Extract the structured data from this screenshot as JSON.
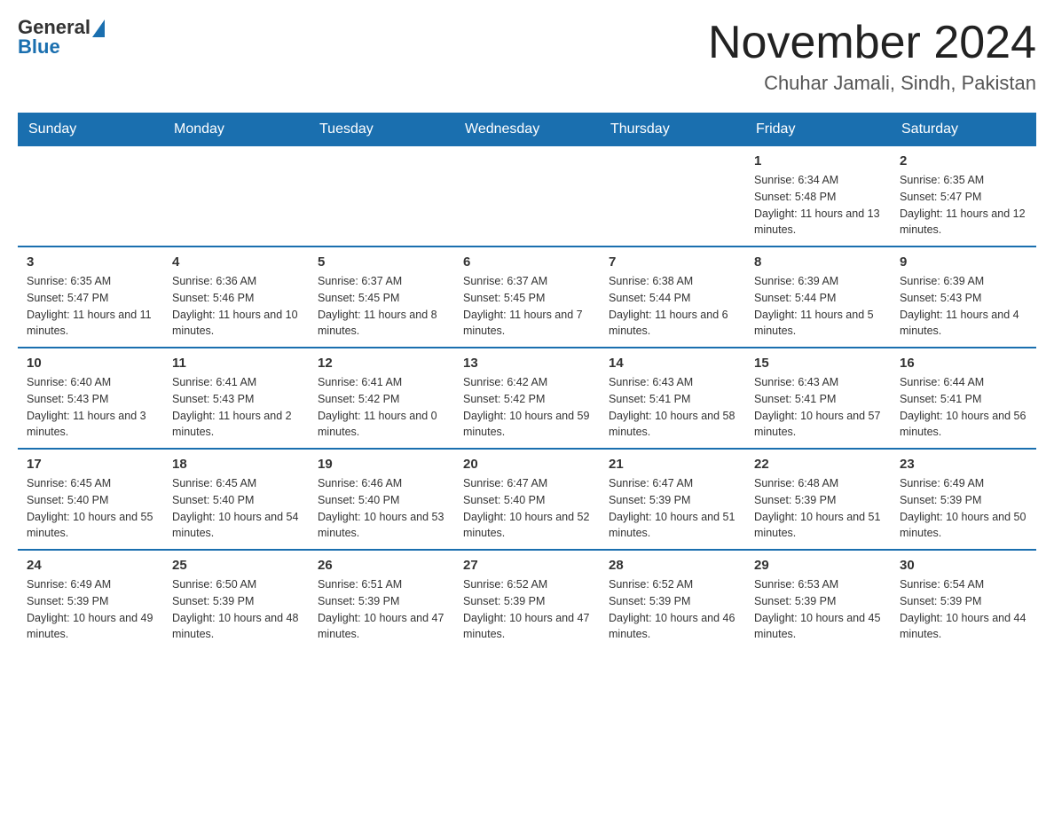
{
  "header": {
    "logo": {
      "general": "General",
      "blue": "Blue"
    },
    "title": "November 2024",
    "subtitle": "Chuhar Jamali, Sindh, Pakistan"
  },
  "calendar": {
    "weekdays": [
      "Sunday",
      "Monday",
      "Tuesday",
      "Wednesday",
      "Thursday",
      "Friday",
      "Saturday"
    ],
    "weeks": [
      [
        {
          "day": "",
          "info": ""
        },
        {
          "day": "",
          "info": ""
        },
        {
          "day": "",
          "info": ""
        },
        {
          "day": "",
          "info": ""
        },
        {
          "day": "",
          "info": ""
        },
        {
          "day": "1",
          "info": "Sunrise: 6:34 AM\nSunset: 5:48 PM\nDaylight: 11 hours and 13 minutes."
        },
        {
          "day": "2",
          "info": "Sunrise: 6:35 AM\nSunset: 5:47 PM\nDaylight: 11 hours and 12 minutes."
        }
      ],
      [
        {
          "day": "3",
          "info": "Sunrise: 6:35 AM\nSunset: 5:47 PM\nDaylight: 11 hours and 11 minutes."
        },
        {
          "day": "4",
          "info": "Sunrise: 6:36 AM\nSunset: 5:46 PM\nDaylight: 11 hours and 10 minutes."
        },
        {
          "day": "5",
          "info": "Sunrise: 6:37 AM\nSunset: 5:45 PM\nDaylight: 11 hours and 8 minutes."
        },
        {
          "day": "6",
          "info": "Sunrise: 6:37 AM\nSunset: 5:45 PM\nDaylight: 11 hours and 7 minutes."
        },
        {
          "day": "7",
          "info": "Sunrise: 6:38 AM\nSunset: 5:44 PM\nDaylight: 11 hours and 6 minutes."
        },
        {
          "day": "8",
          "info": "Sunrise: 6:39 AM\nSunset: 5:44 PM\nDaylight: 11 hours and 5 minutes."
        },
        {
          "day": "9",
          "info": "Sunrise: 6:39 AM\nSunset: 5:43 PM\nDaylight: 11 hours and 4 minutes."
        }
      ],
      [
        {
          "day": "10",
          "info": "Sunrise: 6:40 AM\nSunset: 5:43 PM\nDaylight: 11 hours and 3 minutes."
        },
        {
          "day": "11",
          "info": "Sunrise: 6:41 AM\nSunset: 5:43 PM\nDaylight: 11 hours and 2 minutes."
        },
        {
          "day": "12",
          "info": "Sunrise: 6:41 AM\nSunset: 5:42 PM\nDaylight: 11 hours and 0 minutes."
        },
        {
          "day": "13",
          "info": "Sunrise: 6:42 AM\nSunset: 5:42 PM\nDaylight: 10 hours and 59 minutes."
        },
        {
          "day": "14",
          "info": "Sunrise: 6:43 AM\nSunset: 5:41 PM\nDaylight: 10 hours and 58 minutes."
        },
        {
          "day": "15",
          "info": "Sunrise: 6:43 AM\nSunset: 5:41 PM\nDaylight: 10 hours and 57 minutes."
        },
        {
          "day": "16",
          "info": "Sunrise: 6:44 AM\nSunset: 5:41 PM\nDaylight: 10 hours and 56 minutes."
        }
      ],
      [
        {
          "day": "17",
          "info": "Sunrise: 6:45 AM\nSunset: 5:40 PM\nDaylight: 10 hours and 55 minutes."
        },
        {
          "day": "18",
          "info": "Sunrise: 6:45 AM\nSunset: 5:40 PM\nDaylight: 10 hours and 54 minutes."
        },
        {
          "day": "19",
          "info": "Sunrise: 6:46 AM\nSunset: 5:40 PM\nDaylight: 10 hours and 53 minutes."
        },
        {
          "day": "20",
          "info": "Sunrise: 6:47 AM\nSunset: 5:40 PM\nDaylight: 10 hours and 52 minutes."
        },
        {
          "day": "21",
          "info": "Sunrise: 6:47 AM\nSunset: 5:39 PM\nDaylight: 10 hours and 51 minutes."
        },
        {
          "day": "22",
          "info": "Sunrise: 6:48 AM\nSunset: 5:39 PM\nDaylight: 10 hours and 51 minutes."
        },
        {
          "day": "23",
          "info": "Sunrise: 6:49 AM\nSunset: 5:39 PM\nDaylight: 10 hours and 50 minutes."
        }
      ],
      [
        {
          "day": "24",
          "info": "Sunrise: 6:49 AM\nSunset: 5:39 PM\nDaylight: 10 hours and 49 minutes."
        },
        {
          "day": "25",
          "info": "Sunrise: 6:50 AM\nSunset: 5:39 PM\nDaylight: 10 hours and 48 minutes."
        },
        {
          "day": "26",
          "info": "Sunrise: 6:51 AM\nSunset: 5:39 PM\nDaylight: 10 hours and 47 minutes."
        },
        {
          "day": "27",
          "info": "Sunrise: 6:52 AM\nSunset: 5:39 PM\nDaylight: 10 hours and 47 minutes."
        },
        {
          "day": "28",
          "info": "Sunrise: 6:52 AM\nSunset: 5:39 PM\nDaylight: 10 hours and 46 minutes."
        },
        {
          "day": "29",
          "info": "Sunrise: 6:53 AM\nSunset: 5:39 PM\nDaylight: 10 hours and 45 minutes."
        },
        {
          "day": "30",
          "info": "Sunrise: 6:54 AM\nSunset: 5:39 PM\nDaylight: 10 hours and 44 minutes."
        }
      ]
    ]
  }
}
